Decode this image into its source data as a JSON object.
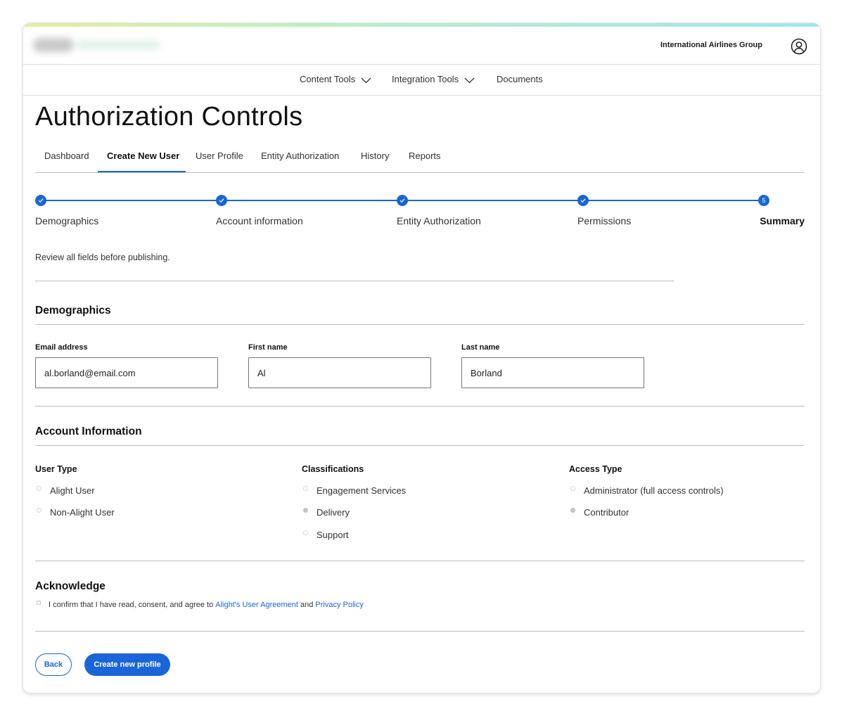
{
  "header": {
    "company": "International Airlines Group"
  },
  "nav": {
    "items": [
      {
        "label": "Content Tools"
      },
      {
        "label": "Integration Tools"
      },
      {
        "label": "Documents"
      }
    ]
  },
  "page": {
    "title": "Authorization Controls"
  },
  "tabs": [
    {
      "label": "Dashboard"
    },
    {
      "label": "Create New User"
    },
    {
      "label": "User Profile"
    },
    {
      "label": "Entity Authorization"
    },
    {
      "label": "History"
    },
    {
      "label": "Reports"
    }
  ],
  "active_tab": "Create New User",
  "stepper": {
    "steps": [
      {
        "label": "Demographics",
        "state": "complete"
      },
      {
        "label": "Account information",
        "state": "complete"
      },
      {
        "label": "Entity Authorization",
        "state": "complete"
      },
      {
        "label": "Permissions",
        "state": "complete"
      },
      {
        "label": "Summary",
        "state": "current",
        "number": "5"
      }
    ]
  },
  "review_note": "Review all fields before publishing.",
  "demographics": {
    "title": "Demographics",
    "email_label": "Email address",
    "email_value": "al.borland@email.com",
    "first_label": "First name",
    "first_value": "Al",
    "last_label": "Last name",
    "last_value": "Borland"
  },
  "account": {
    "title": "Account Information",
    "user_type": {
      "heading": "User Type",
      "options": [
        {
          "label": "Alight User",
          "selected": true
        },
        {
          "label": "Non-Alight User",
          "selected": false
        }
      ]
    },
    "classifications": {
      "heading": "Classifications",
      "options": [
        {
          "label": "Engagement Services",
          "selected": false
        },
        {
          "label": "Delivery",
          "selected": true
        },
        {
          "label": "Support",
          "selected": false
        }
      ]
    },
    "access_type": {
      "heading": "Access Type",
      "options": [
        {
          "label": "Administrator (full access controls)",
          "selected": false
        },
        {
          "label": "Contributor",
          "selected": true
        }
      ]
    }
  },
  "acknowledge": {
    "title": "Acknowledge",
    "text_before": "I confirm that I have read, consent, and agree to",
    "link1": "Alight's User Agreement",
    "text_mid": "and",
    "link2": "Privacy Policy"
  },
  "buttons": {
    "back": "Back",
    "create": "Create new profile"
  },
  "colors": {
    "accent": "#1a66d8",
    "divider": "#bdbdbd"
  }
}
